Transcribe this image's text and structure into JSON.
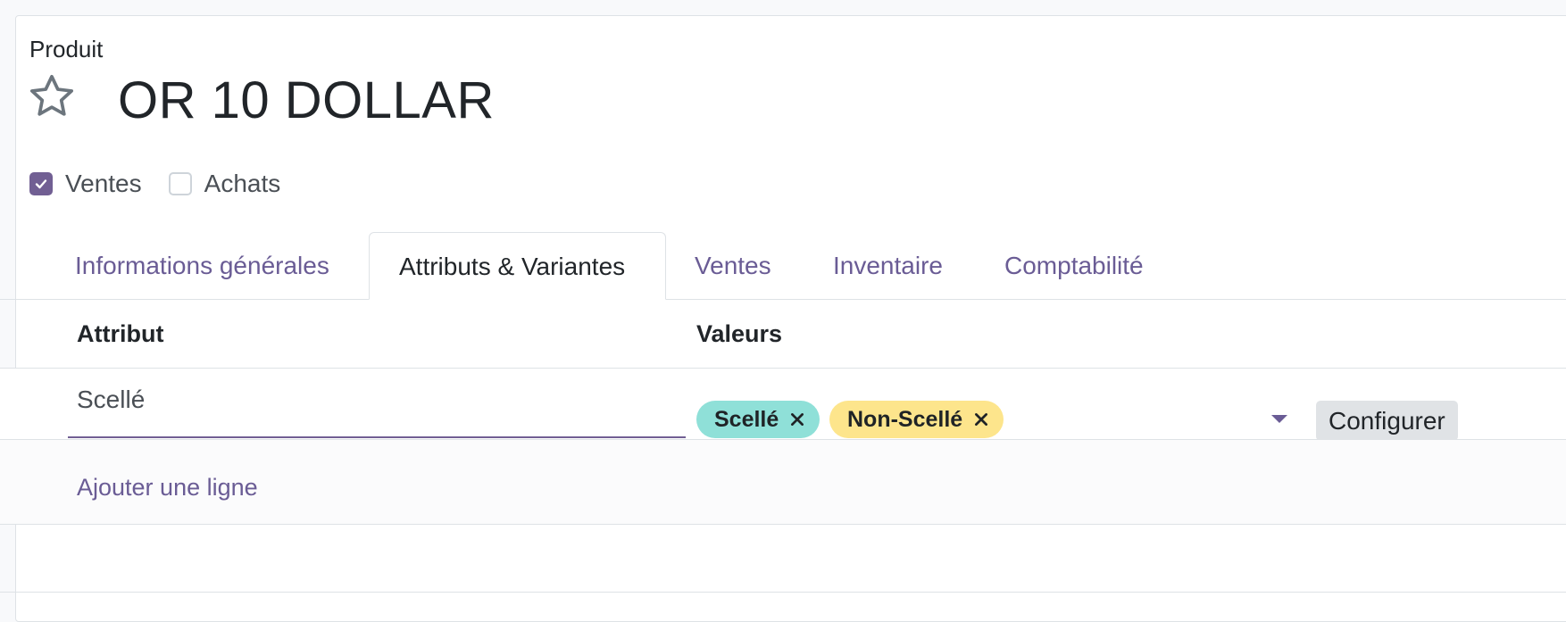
{
  "form": {
    "record_label": "Produit",
    "product_name": "OR 10 DOLLAR",
    "favorite_icon": "star-outline-icon"
  },
  "options": [
    {
      "label": "Ventes",
      "checked": true
    },
    {
      "label": "Achats",
      "checked": false
    }
  ],
  "tabs": [
    {
      "label": "Informations générales",
      "active": false
    },
    {
      "label": "Attributs & Variantes",
      "active": true
    },
    {
      "label": "Ventes",
      "active": false
    },
    {
      "label": "Inventaire",
      "active": false
    },
    {
      "label": "Comptabilité",
      "active": false
    }
  ],
  "table": {
    "headers": {
      "attribute": "Attribut",
      "values": "Valeurs"
    },
    "rows": [
      {
        "attribute": "Scellé",
        "values": [
          {
            "label": "Scellé",
            "color": "#8fe0d8"
          },
          {
            "label": "Non-Scellé",
            "color": "#fde58c"
          }
        ],
        "configure_label": "Configurer"
      }
    ],
    "add_line_label": "Ajouter une ligne"
  },
  "colors": {
    "accent": "#715f93",
    "link": "#6a5c95"
  }
}
